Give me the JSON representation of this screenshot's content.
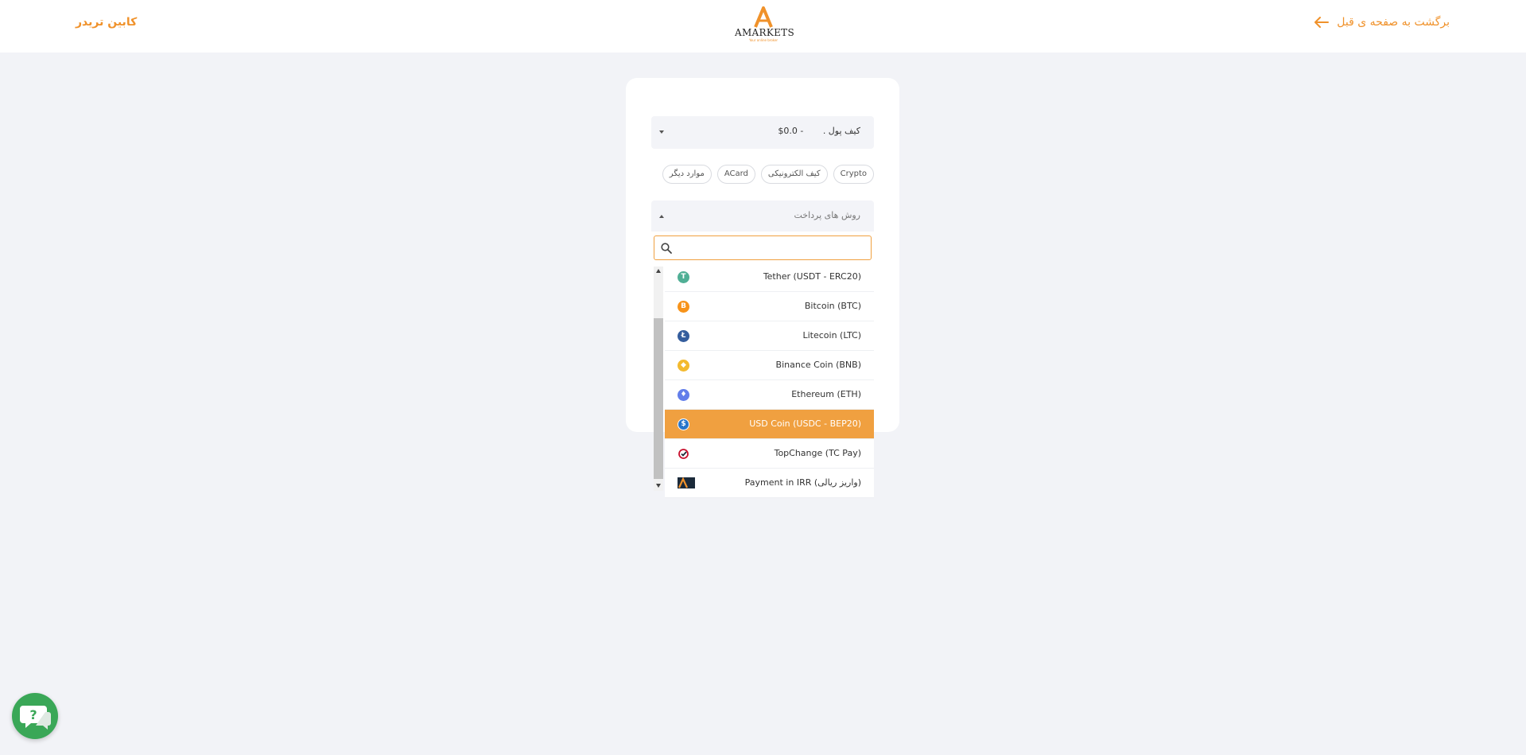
{
  "header": {
    "back_label": "برگشت به صفحه ی قبل",
    "cabinet_label": "کابین تریدر",
    "logo": {
      "name": "AMARKETS",
      "tagline": "Your online broker"
    },
    "accent_color": "#f0922b"
  },
  "form": {
    "wallet_value": "کیف پول . ‌ ‌ ‌ ‌ ‌ ‌ - 0.0$",
    "chips": [
      "Crypto",
      "کیف الکترونیکی",
      "ACard",
      "موارد دیگر"
    ],
    "method_placeholder": "روش های پرداخت",
    "search": {
      "value": "",
      "placeholder": ""
    },
    "options": [
      {
        "label": "Tether (USDT - ERC20)",
        "icon": "tether-icon",
        "color": "#50af95",
        "glyph": "T"
      },
      {
        "label": "Bitcoin (BTC)",
        "icon": "bitcoin-icon",
        "color": "#f7931a",
        "glyph": "₿"
      },
      {
        "label": "Litecoin (LTC)",
        "icon": "litecoin-icon",
        "color": "#345d9d",
        "glyph": "Ł"
      },
      {
        "label": "Binance Coin (BNB)",
        "icon": "binance-icon",
        "color": "#f3ba2f",
        "glyph": "◆"
      },
      {
        "label": "Ethereum (ETH)",
        "icon": "ethereum-icon",
        "color": "#627eea",
        "glyph": "♦"
      },
      {
        "label": "USD Coin (USDC - BEP20)",
        "icon": "usdc-icon",
        "color": "#2775ca",
        "glyph": "$",
        "selected": true
      },
      {
        "label": "TopChange (TC Pay)",
        "icon": "topchange-icon",
        "color": "#ffffff",
        "glyph": ""
      },
      {
        "label": "Payment in IRR (واریز ریالی)",
        "icon": "irr-icon",
        "color": "#1b2a3a",
        "glyph": ""
      }
    ],
    "selected_color": "#f0a040"
  },
  "help": {
    "icon": "chat-help-icon",
    "color": "#3aa757"
  }
}
